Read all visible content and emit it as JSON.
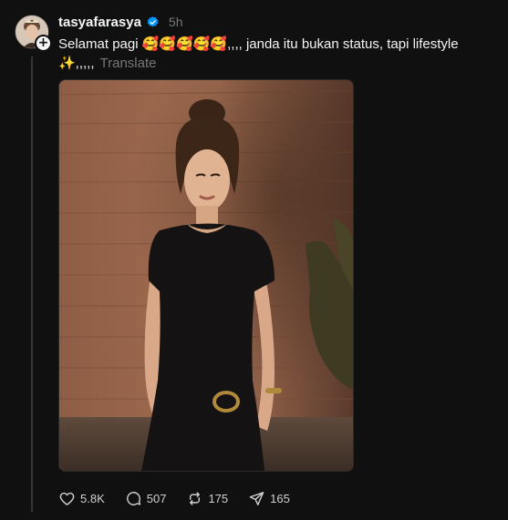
{
  "post": {
    "username": "tasyafarasya",
    "timestamp": "5h",
    "caption_line1": "Selamat pagi 🥰🥰🥰🥰🥰,,,, janda itu bukan status, tapi lifestyle",
    "caption_line2": "✨,,,,,",
    "translate_label": "Translate",
    "verified_icon": "verified-badge-icon",
    "colors": {
      "background": "#101010",
      "text": "#f3f5f7",
      "muted": "#777777",
      "verified": "#0095f6",
      "thread_line": "#333638"
    }
  },
  "actions": {
    "like_count": "5.8K",
    "reply_count": "507",
    "repost_count": "175",
    "share_count": "165",
    "icons": [
      "heart-icon",
      "comment-icon",
      "repost-icon",
      "share-icon"
    ]
  }
}
